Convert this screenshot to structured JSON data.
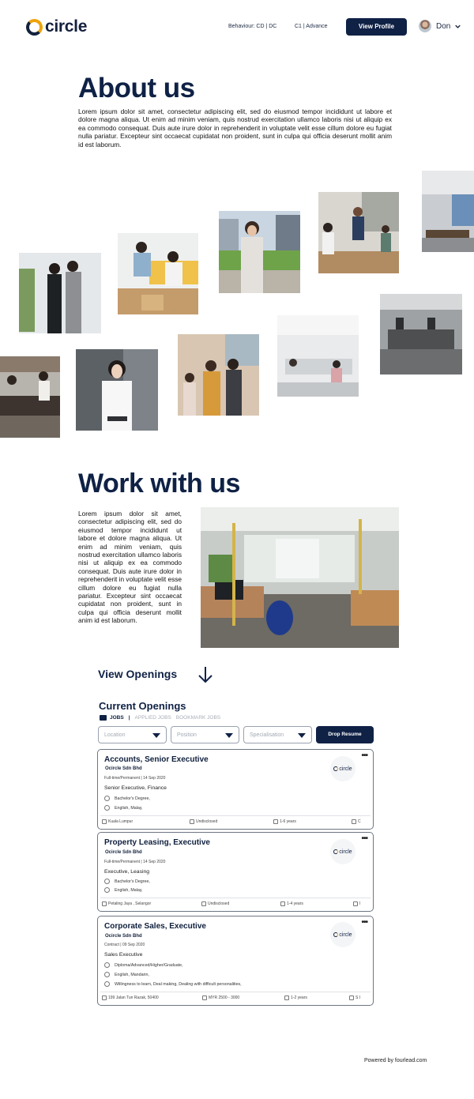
{
  "header": {
    "logo_text": "circle",
    "behaviour": "Behaviour: CD | DC",
    "level": "C1 | Advance",
    "view_profile": "View Profile",
    "user_name": "Don"
  },
  "about": {
    "title": "About us",
    "body": "Lorem ipsum dolor sit amet, consectetur adipiscing elit, sed do eiusmod tempor incididunt ut labore et dolore magna aliqua. Ut enim ad minim veniam, quis nostrud exercitation ullamco laboris nisi ut aliquip ex ea commodo consequat. Duis aute irure dolor in reprehenderit in voluptate velit esse cillum dolore eu fugiat nulla pariatur. Excepteur sint occaecat cupidatat non proident, sunt in culpa qui officia deserunt mollit anim id est laborum."
  },
  "work": {
    "title": "Work with us",
    "body": "Lorem ipsum dolor sit amet, consectetur adipiscing elit, sed do eiusmod tempor incididunt ut labore et dolore magna aliqua. Ut enim ad minim veniam, quis nostrud exercitation ullamco laboris nisi ut aliquip ex ea commodo consequat. Duis aute irure dolor in reprehenderit in voluptate velit esse cillum dolore eu fugiat nulla pariatur. Excepteur sint occaecat cupidatat non proident, sunt in culpa qui officia deserunt mollit anim id est laborum."
  },
  "openings": {
    "view_openings": "View Openings",
    "current_title": "Current Openings",
    "tab_jobs": "JOBS",
    "tab_sep": "|",
    "tab_applied": "APPLIED JOBS",
    "tab_bookmark": "BOOKMARK JOBS",
    "filter_location": "Location",
    "filter_position": "Position",
    "filter_specialisation": "Specialisation",
    "drop_resume": "Drop Resume"
  },
  "jobs": [
    {
      "title": "Accounts, Senior Executive",
      "company": "Ocircle Sdn Bhd",
      "meta": "Full-time/Permanent | 14 Sep 2020",
      "role": "Senior Executive, Finance",
      "education": "Bachelor's Degree,",
      "languages": "English,   Malay,",
      "location": "Kuala Lumpur",
      "salary": "Undisclosed",
      "experience": "1-6 years",
      "grade": "C",
      "logo_text": "circle"
    },
    {
      "title": "Property Leasing, Executive",
      "company": "Ocircle Sdn Bhd",
      "meta": "Full-time/Permanent | 14 Sep 2020",
      "role": "Executive, Leasing",
      "education": "Bachelor's Degree,",
      "languages": "English,   Malay,",
      "location": "Petaling Jaya , Selangor",
      "salary": "Undisclosed",
      "experience": "1-4 years",
      "grade": "I",
      "logo_text": "circle"
    },
    {
      "title": "Corporate Sales, Executive",
      "company": "Ocircle Sdn Bhd",
      "meta": "Contract | 09 Sep 2020",
      "role": "Sales Executive",
      "education": "Diploma/Advanced/Higher/Graduate,",
      "languages": "English,   Mandarin,",
      "skills": "Willingness to learn,   Deal making,   Dealing with difficult personalities,",
      "location": "199 Jalan Tun Razak, 50400",
      "salary": "MYR 2500 - 3000",
      "experience": "1-2 years",
      "grade": "S I",
      "logo_text": "circle"
    }
  ],
  "footer": {
    "powered": "Powered by fourlead.com"
  },
  "colors": {
    "navy": "#0f2145",
    "accent": "#f0a30a"
  }
}
